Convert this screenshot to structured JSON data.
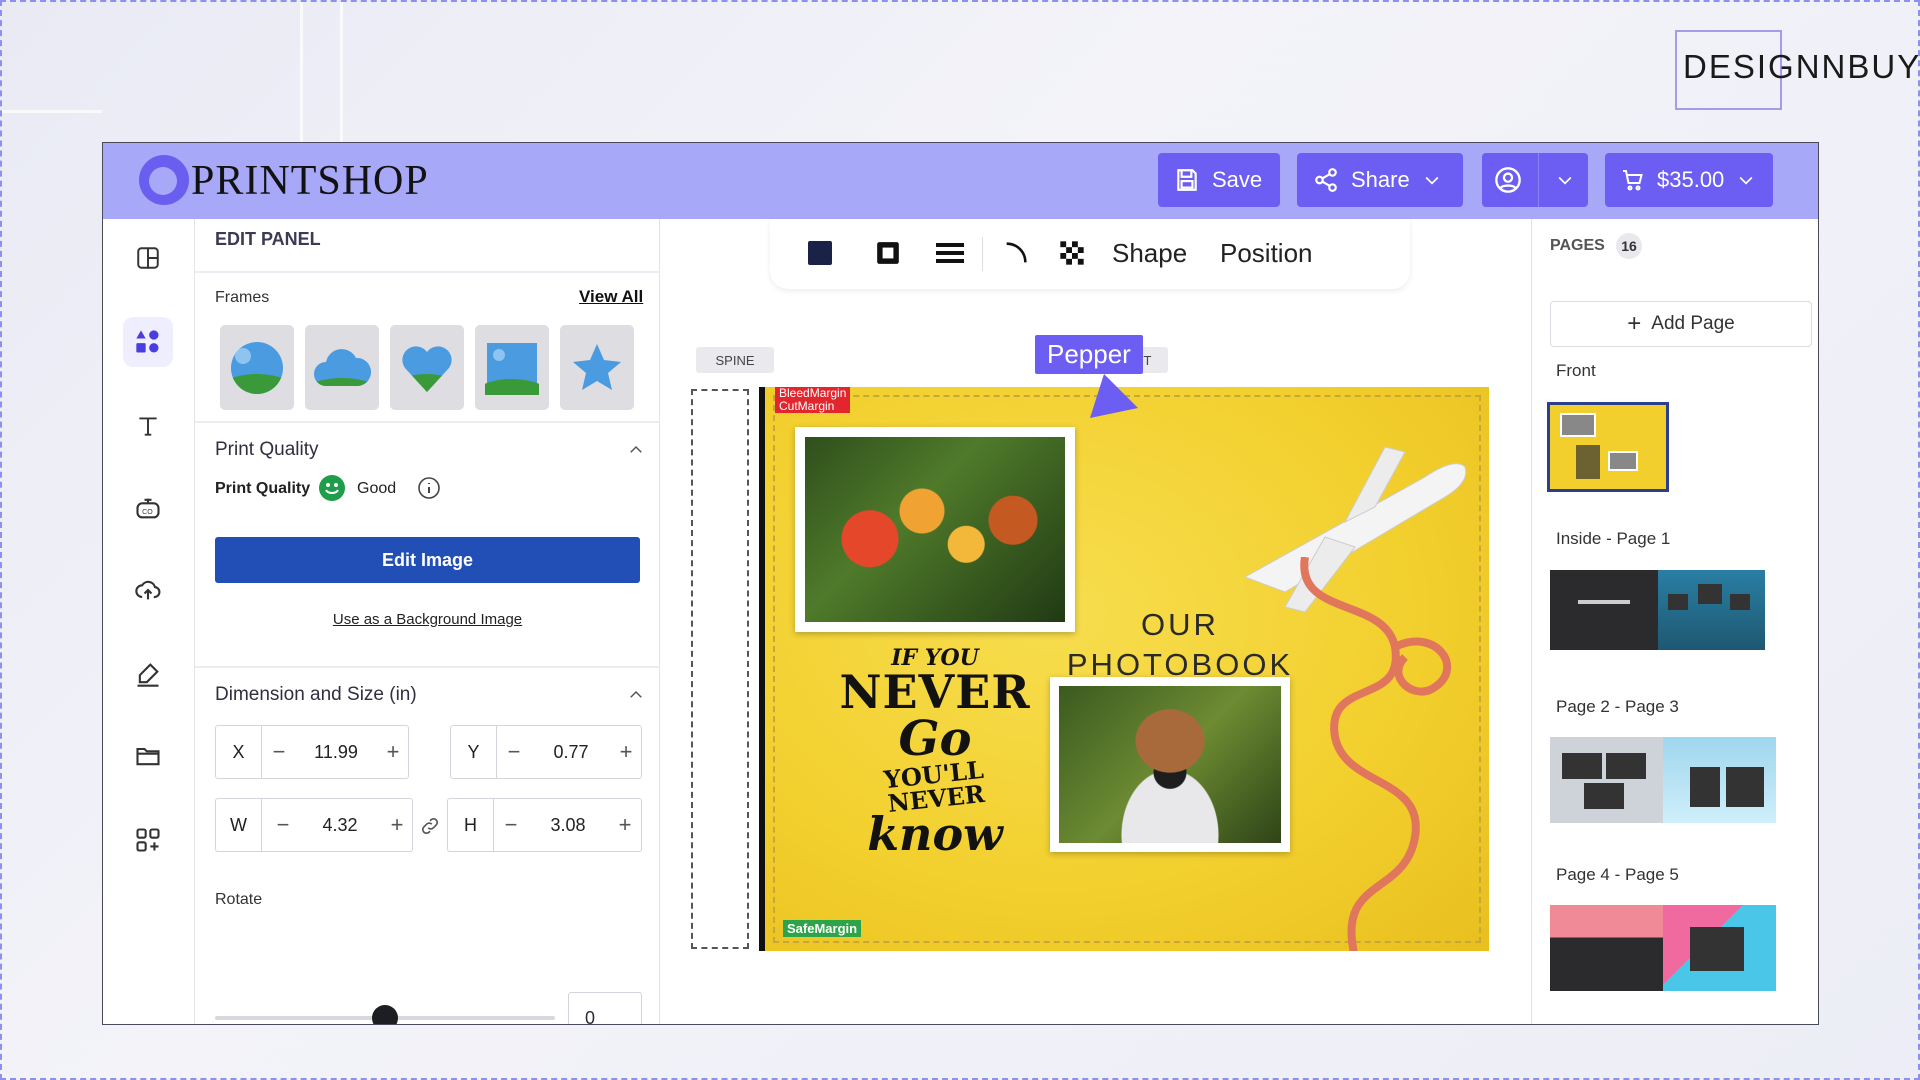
{
  "brand": "DESIGNNBUY",
  "app": {
    "logo_text": "PRINTSHOP",
    "save_label": "Save",
    "share_label": "Share",
    "cart_price": "$35.00"
  },
  "rail": {
    "items": [
      "layout-icon",
      "elements-icon",
      "text-icon",
      "ai-icon",
      "upload-icon",
      "draw-icon",
      "folder-icon",
      "apps-icon"
    ]
  },
  "edit_panel": {
    "title": "EDIT PANEL",
    "frames_label": "Frames",
    "view_all": "View All",
    "print_quality_header": "Print Quality",
    "print_quality_label": "Print Quality",
    "print_quality_value": "Good",
    "edit_image": "Edit Image",
    "use_as_background": "Use as a Background Image",
    "dimension_header": "Dimension and Size (in)",
    "x_label": "X",
    "x_value": "11.99",
    "y_label": "Y",
    "y_value": "0.77",
    "w_label": "W",
    "w_value": "4.32",
    "h_label": "H",
    "h_value": "3.08",
    "rotate_label": "Rotate",
    "rotate_value": "0",
    "rotate_fraction": 0.5
  },
  "toolbar": {
    "shape": "Shape",
    "position": "Position"
  },
  "canvas": {
    "spine_tag": "SPINE",
    "front_tag": "FRONT",
    "bleed_margin": "BleedMargin",
    "cut_margin": "CutMargin",
    "safe_margin": "SafeMargin",
    "title_line1": "OUR",
    "title_line2": "PHOTOBOOK",
    "quote_line1": "IF YOU",
    "quote_line2": "NEVER",
    "quote_line3": "Go",
    "quote_line4": "YOU'LL NEVER",
    "quote_line5": "know",
    "cursor_name": "Pepper"
  },
  "pages_panel": {
    "title": "PAGES",
    "count": "16",
    "add_page": "Add Page",
    "pages": [
      {
        "label": "Front"
      },
      {
        "label": "Inside - Page 1"
      },
      {
        "label": "Page 2 - Page 3"
      },
      {
        "label": "Page 4 - Page 5"
      }
    ]
  },
  "colors": {
    "accent": "#6c5ef2",
    "topbar": "#a8a8f8",
    "edit_button": "#214fb5",
    "cover": "#f2cf2d"
  }
}
